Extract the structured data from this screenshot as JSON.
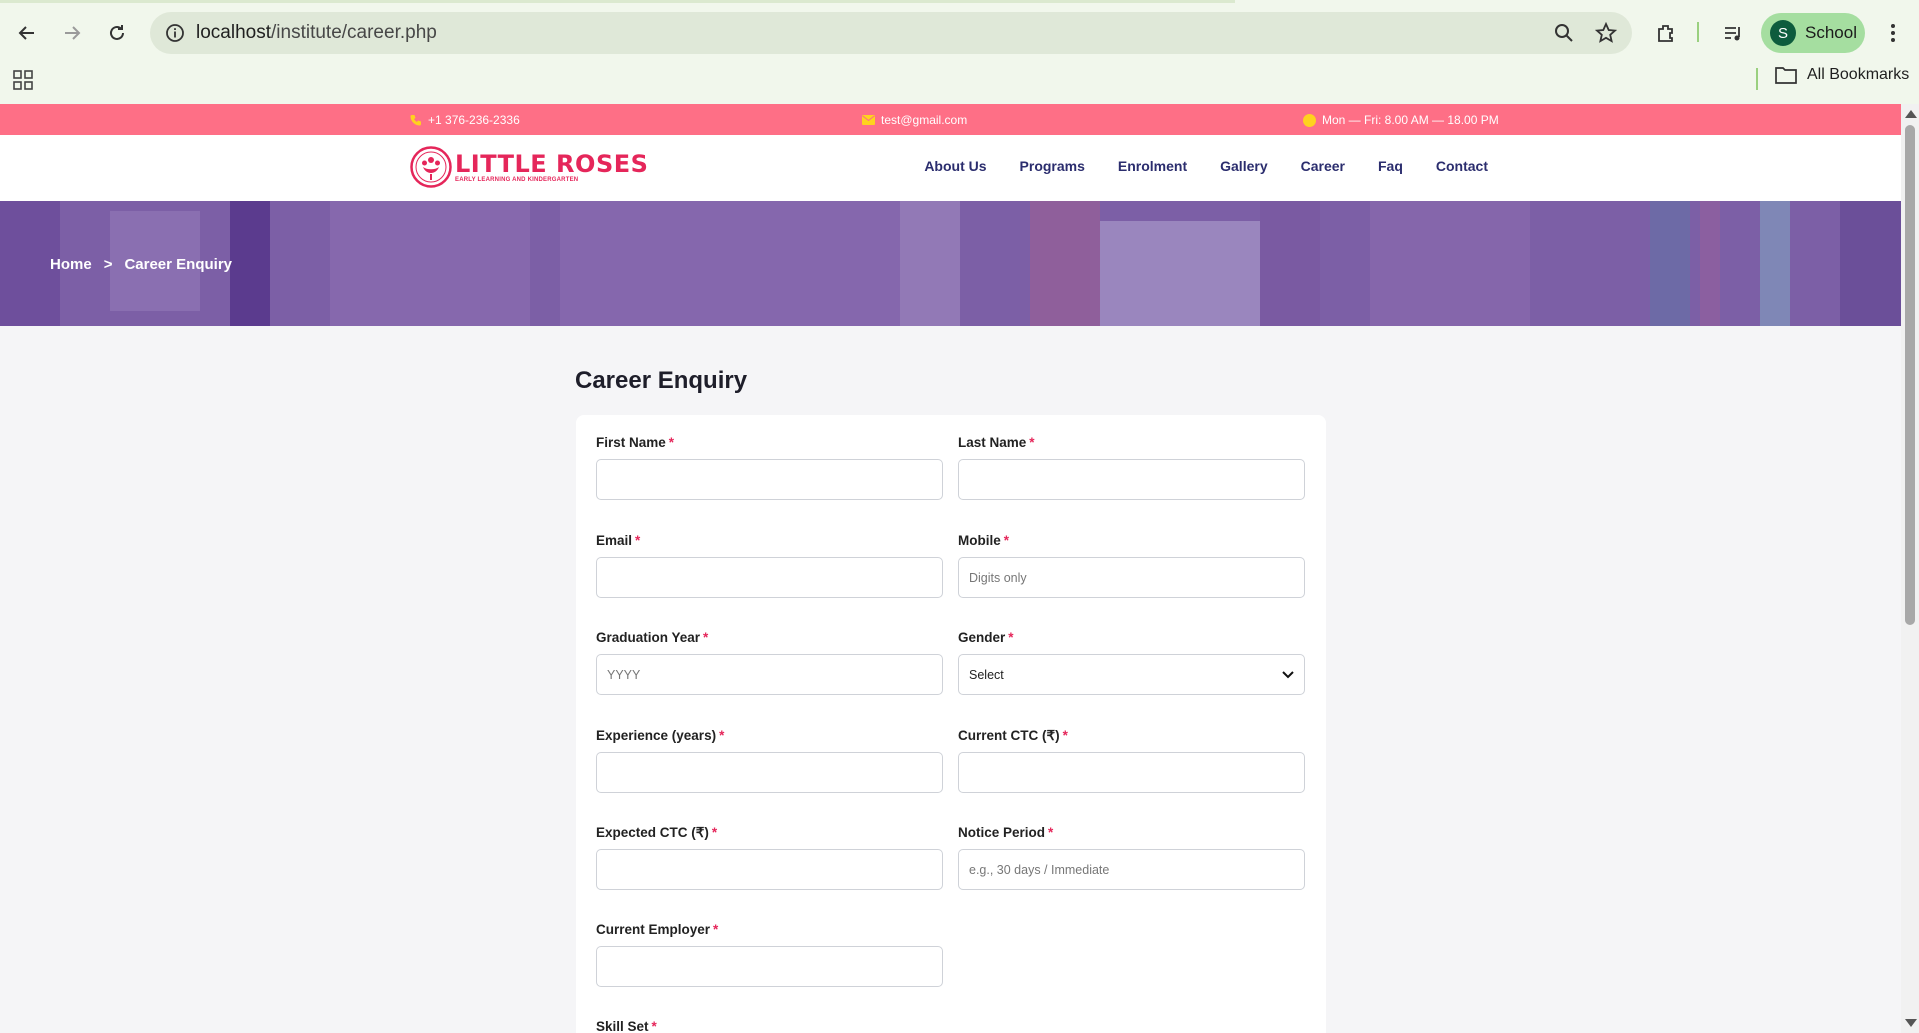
{
  "browser": {
    "url_host": "localhost",
    "url_path": "/institute/career.php",
    "profile_initial": "S",
    "profile_name": "School",
    "all_bookmarks": "All Bookmarks"
  },
  "topbar": {
    "phone": "+1 376-236-2336",
    "email": "test@gmail.com",
    "hours": "Mon — Fri: 8.00 AM — 18.00 PM"
  },
  "brand": {
    "name": "LITTLE ROSES",
    "tagline": "EARLY LEARNING AND KINDERGARTEN",
    "color": "#e5265a"
  },
  "menu": [
    "About Us",
    "Programs",
    "Enrolment",
    "Gallery",
    "Career",
    "Faq",
    "Contact"
  ],
  "breadcrumb": {
    "home": "Home",
    "sep": ">",
    "current": "Career Enquiry"
  },
  "form": {
    "title": "Career Enquiry",
    "fields": {
      "first_name": {
        "label": "First Name",
        "placeholder": ""
      },
      "last_name": {
        "label": "Last Name",
        "placeholder": ""
      },
      "email": {
        "label": "Email",
        "placeholder": ""
      },
      "mobile": {
        "label": "Mobile",
        "placeholder": "Digits only"
      },
      "graduation_year": {
        "label": "Graduation Year",
        "placeholder": "YYYY"
      },
      "gender": {
        "label": "Gender",
        "value": "Select"
      },
      "experience": {
        "label": "Experience (years)",
        "placeholder": ""
      },
      "current_ctc": {
        "label": "Current CTC (₹)",
        "placeholder": ""
      },
      "expected_ctc": {
        "label": "Expected CTC (₹)",
        "placeholder": ""
      },
      "notice_period": {
        "label": "Notice Period",
        "placeholder": "e.g., 30 days / Immediate"
      },
      "current_employer": {
        "label": "Current Employer",
        "placeholder": ""
      },
      "skill_set": {
        "label": "Skill Set"
      }
    },
    "required_mark": "*"
  },
  "colors": {
    "topbar": "#fe6f86",
    "menu": "#2b2d6e",
    "hero_overlay": "#7c5fa6"
  }
}
